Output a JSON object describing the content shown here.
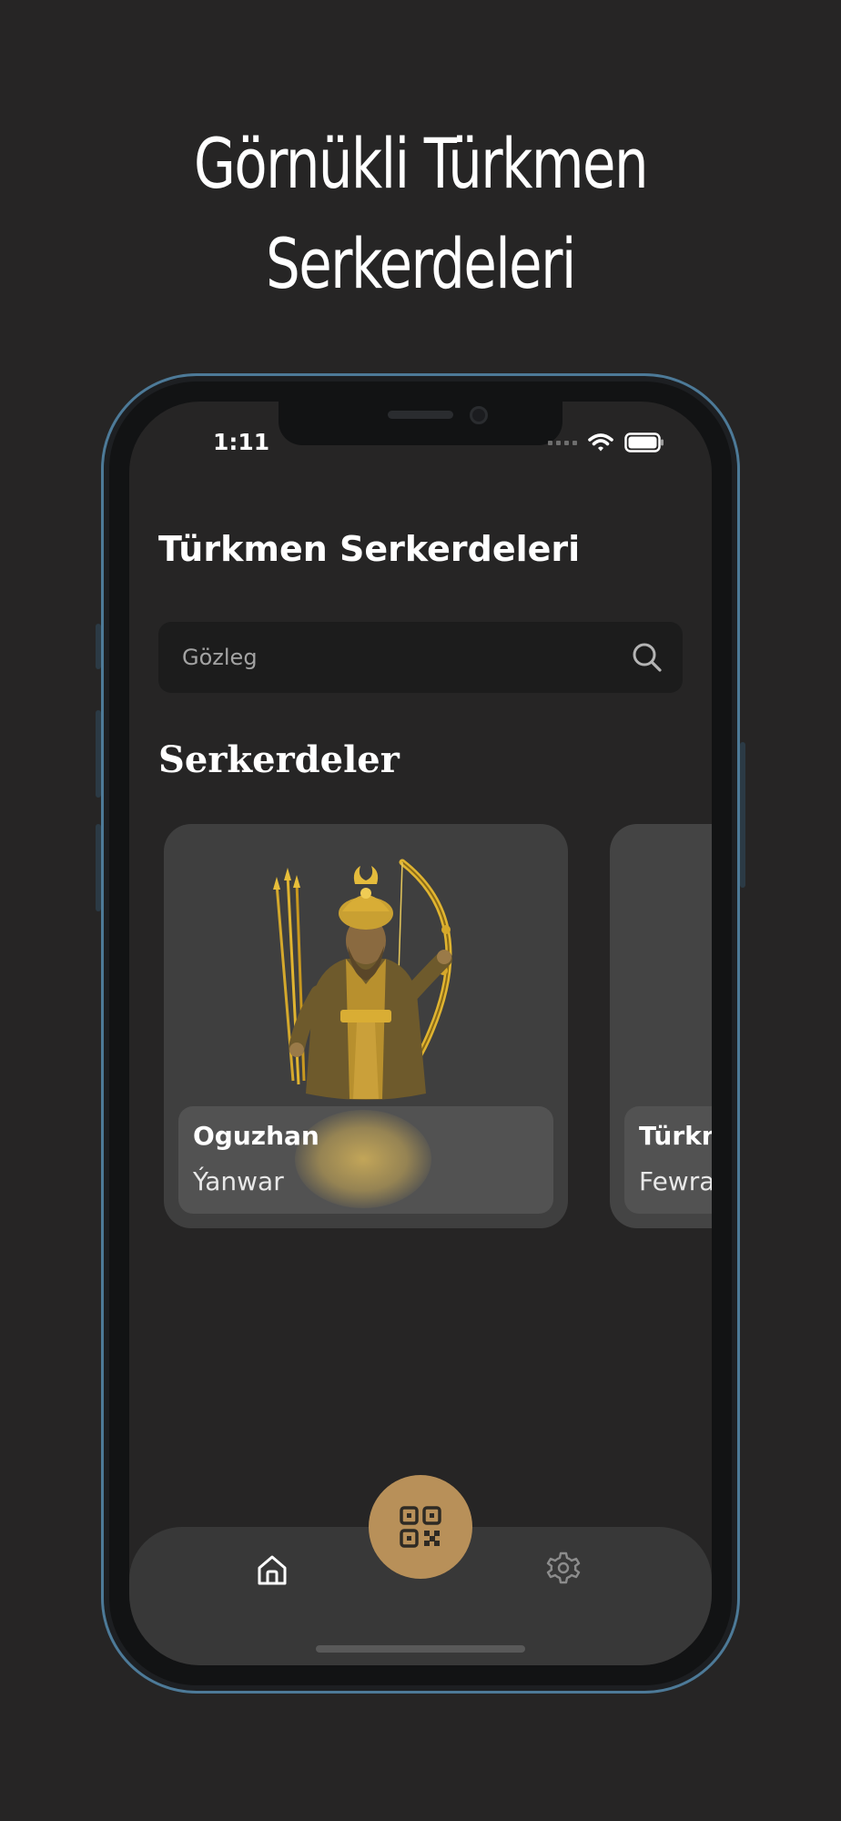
{
  "promo": {
    "title_line1": "Görnükli Türkmen",
    "title_line2": "Serkerdeleri"
  },
  "status_bar": {
    "time": "1:11"
  },
  "app": {
    "title": "Türkmen Serkerdeleri",
    "search": {
      "placeholder": "Gözleg",
      "value": ""
    },
    "section_title": "Serkerdeler",
    "cards": [
      {
        "name": "Oguzhan",
        "date": "Ýanwar"
      },
      {
        "name": "Türkm",
        "date": "Fewra"
      }
    ]
  },
  "tab_bar": {
    "items": [
      {
        "icon": "home-icon",
        "active": true
      },
      {
        "icon": "qr-code-icon",
        "active": false
      },
      {
        "icon": "gear-icon",
        "active": false
      }
    ]
  },
  "colors": {
    "background": "#262525",
    "card": "#3f3f3f",
    "card_info": "#525252",
    "accent_gold": "#b89059",
    "tab_bar": "#383838",
    "search_bg": "#1c1c1c",
    "phone_bezel_edge": "#4d7a98"
  }
}
